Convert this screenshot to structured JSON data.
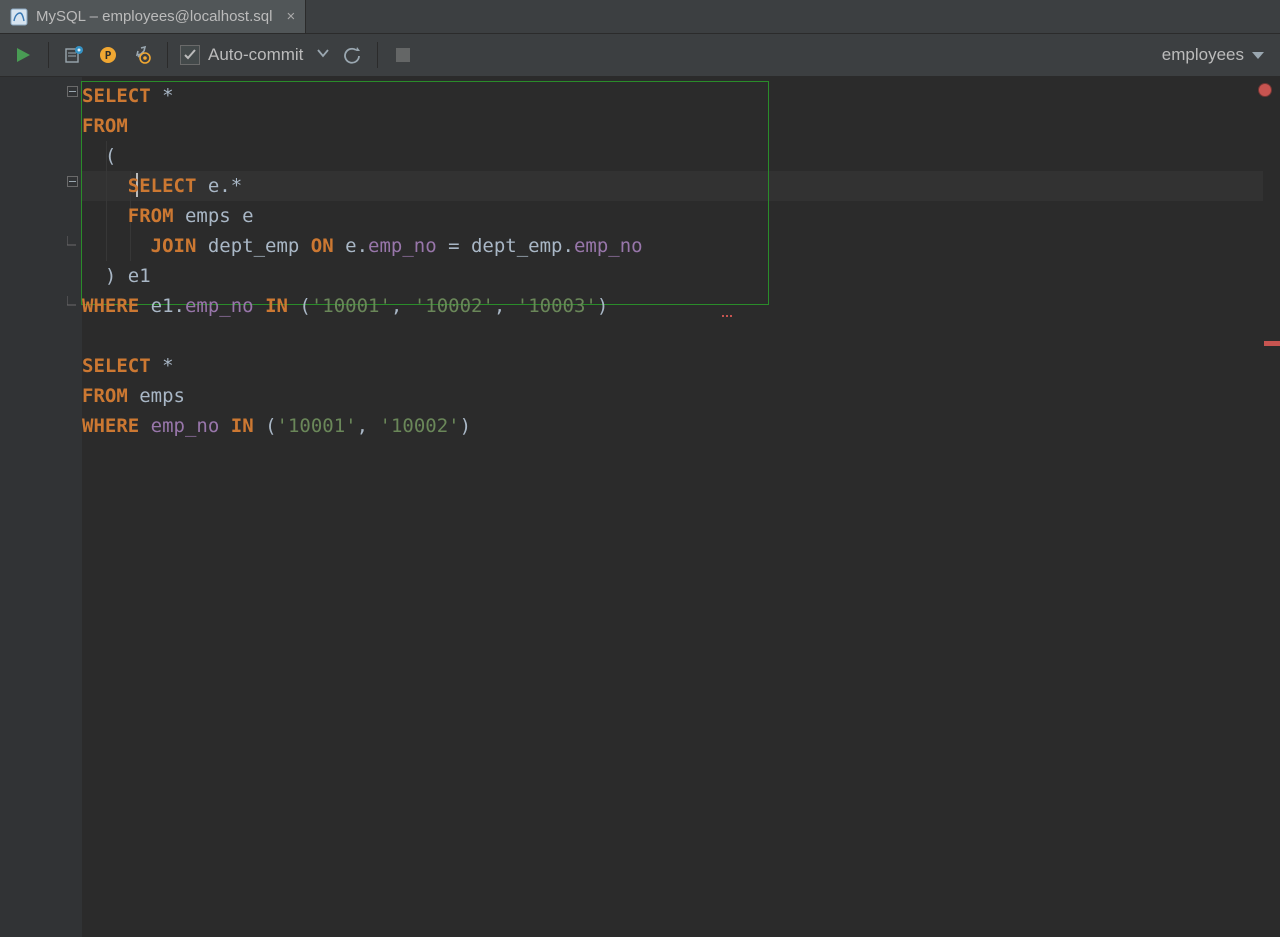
{
  "tab": {
    "title": "MySQL – employees@localhost.sql"
  },
  "toolbar": {
    "auto_commit_label": "Auto-commit"
  },
  "schema": {
    "selected": "employees"
  },
  "code": {
    "l1": {
      "a": "SELECT",
      "b": " *"
    },
    "l2": {
      "a": "FROM"
    },
    "l3": {
      "a": "  ("
    },
    "l4": {
      "a": "    ",
      "b": "SELECT",
      "c": " e.",
      "d": "*"
    },
    "l5": {
      "a": "    ",
      "b": "FROM",
      "c": " emps e"
    },
    "l6": {
      "a": "      ",
      "b": "JOIN",
      "c": " dept_emp ",
      "d": "ON",
      "e": " e.",
      "f": "emp_no",
      "g": " = dept_emp.",
      "h": "emp_no"
    },
    "l7": {
      "a": "  ) e1"
    },
    "l8": {
      "a": "WHERE",
      "b": " e1.",
      "c": "emp_no",
      "d": " ",
      "e": "IN",
      "f": " (",
      "g": "'10001'",
      "h": ", ",
      "i": "'10002'",
      "j": ", ",
      "k": "'10003'",
      "l": ")"
    },
    "l9": "",
    "l10": {
      "a": "SELECT",
      "b": " *"
    },
    "l11": {
      "a": "FROM",
      "b": " emps"
    },
    "l12": {
      "a": "WHERE",
      "b": " ",
      "c": "emp_no",
      "d": " ",
      "e": "IN",
      "f": " (",
      "g": "'10001'",
      "h": ", ",
      "i": "'10002'",
      "j": ")"
    }
  }
}
